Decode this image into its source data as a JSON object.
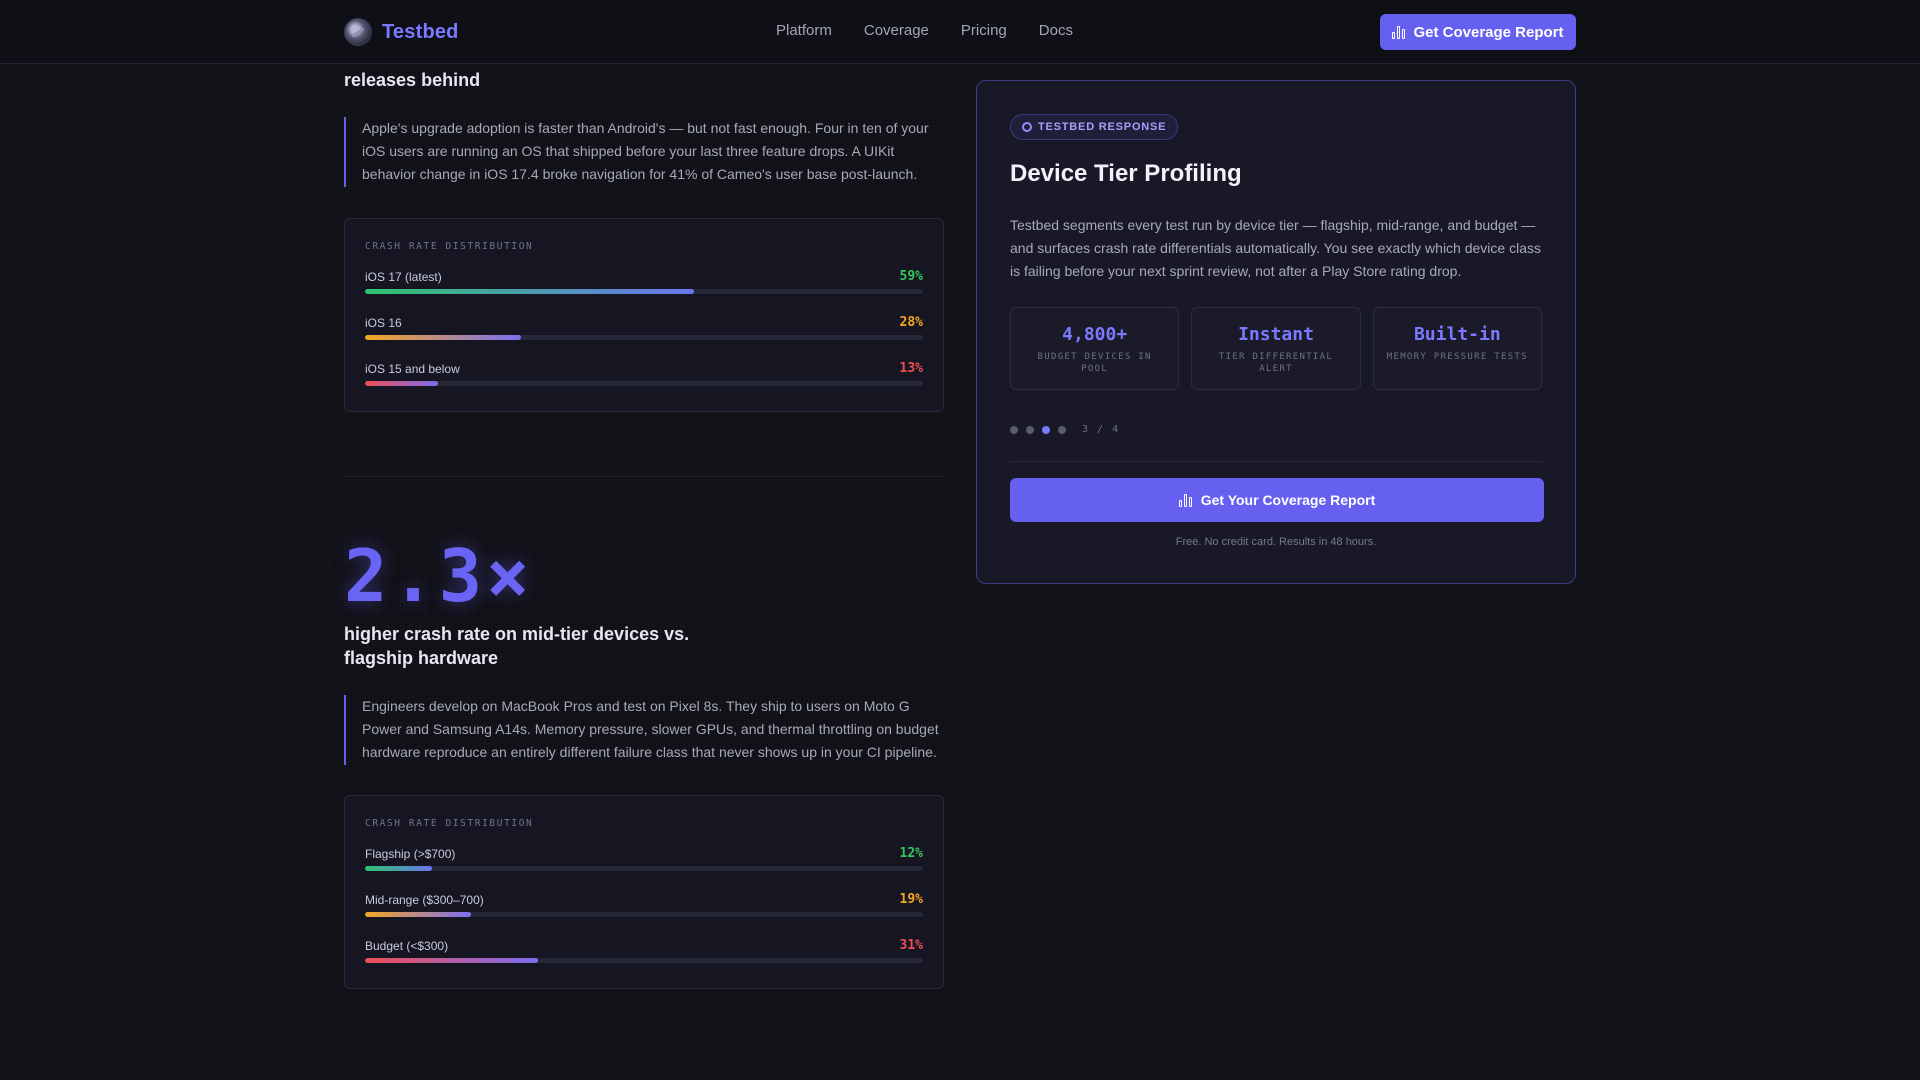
{
  "nav": {
    "brand": "Testbed",
    "links": [
      "Platform",
      "Coverage",
      "Pricing",
      "Docs"
    ],
    "cta_label": "Get Coverage Report"
  },
  "section1": {
    "heading_tail": "releases behind",
    "quote": "Apple's upgrade adoption is faster than Android's — but not fast enough. Four in ten of your iOS users are running an OS that shipped before your last three feature drops. A UIKit behavior change in iOS 17.4 broke navigation for 41% of Cameo's user base post-launch.",
    "distribution": {
      "title": "CRASH RATE DISTRIBUTION",
      "rows": [
        {
          "label": "iOS 17 (latest)",
          "value": "59%",
          "fraction": 0.59,
          "tone": "green"
        },
        {
          "label": "iOS 16",
          "value": "28%",
          "fraction": 0.28,
          "tone": "orange"
        },
        {
          "label": "iOS 15 and below",
          "value": "13%",
          "fraction": 0.13,
          "tone": "red"
        }
      ]
    }
  },
  "section2": {
    "big_stat": "2.3×",
    "heading": "higher crash rate on mid-tier devices vs. flagship hardware",
    "quote": "Engineers develop on MacBook Pros and test on Pixel 8s. They ship to users on Moto G Power and Samsung A14s. Memory pressure, slower GPUs, and thermal throttling on budget hardware reproduce an entirely different failure class that never shows up in your CI pipeline.",
    "distribution": {
      "title": "CRASH RATE DISTRIBUTION",
      "rows": [
        {
          "label": "Flagship (>$700)",
          "value": "12%",
          "fraction": 0.12,
          "tone": "green"
        },
        {
          "label": "Mid-range ($300–700)",
          "value": "19%",
          "fraction": 0.19,
          "tone": "orange"
        },
        {
          "label": "Budget (<$300)",
          "value": "31%",
          "fraction": 0.31,
          "tone": "red"
        }
      ]
    }
  },
  "response_card": {
    "badge": "TESTBED RESPONSE",
    "title": "Device Tier Profiling",
    "description": "Testbed segments every test run by device tier — flagship, mid-range, and budget — and surfaces crash rate differentials automatically. You see exactly which device class is failing before your next sprint review, not after a Play Store rating drop.",
    "stats": [
      {
        "value": "4,800+",
        "label": "BUDGET DEVICES IN POOL"
      },
      {
        "value": "Instant",
        "label": "TIER DIFFERENTIAL ALERT"
      },
      {
        "value": "Built-in",
        "label": "MEMORY PRESSURE TESTS"
      }
    ],
    "pager": {
      "current": 3,
      "total": 4,
      "text": "3 / 4"
    },
    "cta_label": "Get Your Coverage Report",
    "fine_print": "Free. No credit card. Results in 48 hours."
  },
  "colors": {
    "accent": "#6660f0",
    "green": "#34c759",
    "orange": "#f5a623",
    "red": "#ef4d56"
  },
  "icons": {
    "brand": "testbed-logo",
    "cta": "bar-chart-icon",
    "badge": "gear-icon"
  }
}
